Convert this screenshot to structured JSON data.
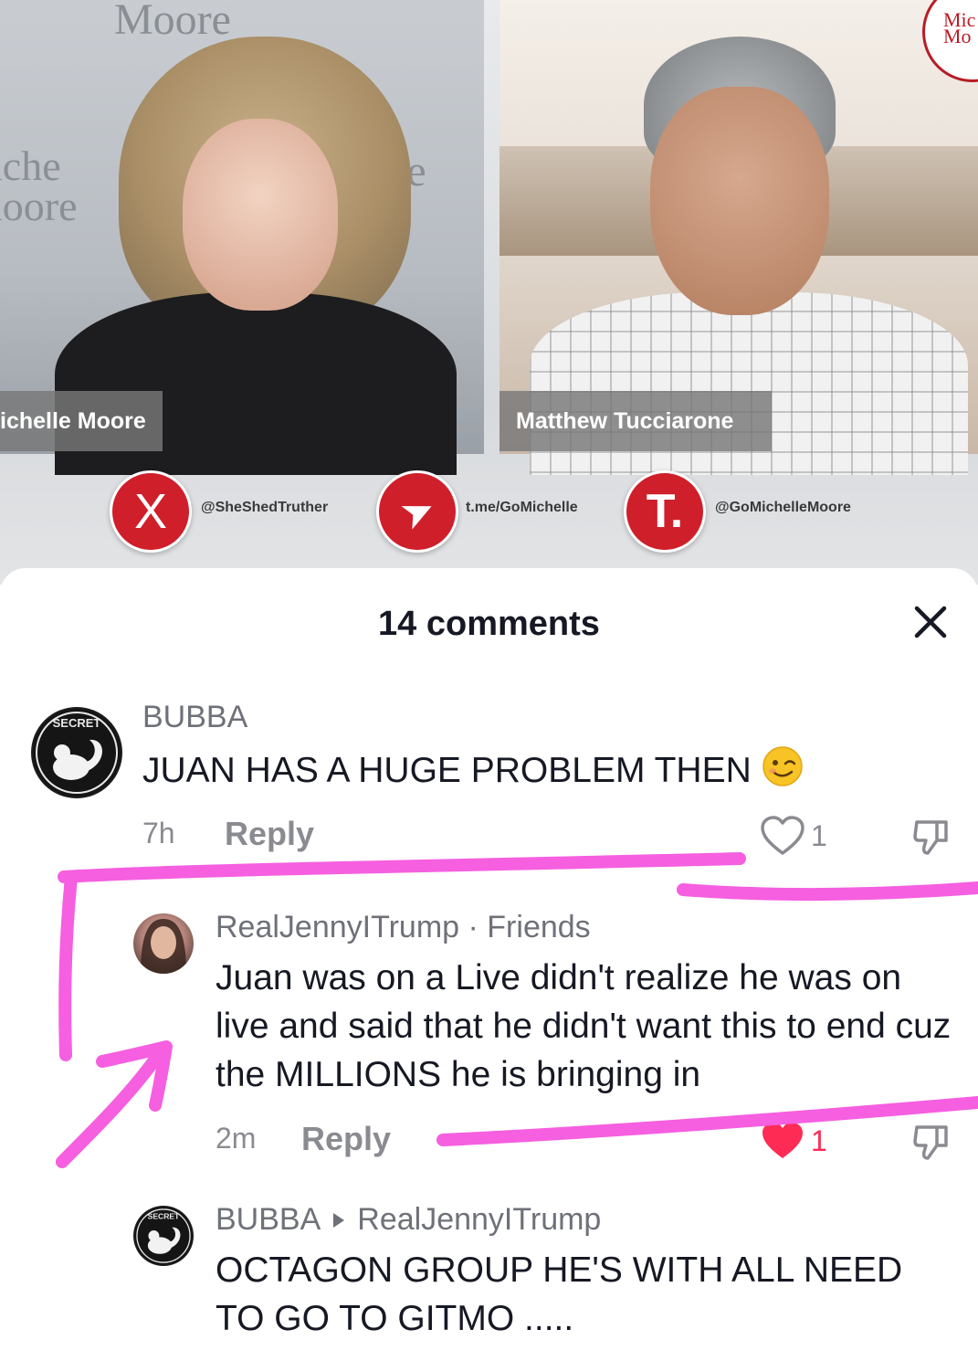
{
  "video": {
    "left_wall_text_top": "Moore",
    "left_wall_text_side": "iche\nloore",
    "left_wall_text_le": "le",
    "right_wall_text": "Mo",
    "host_name": "ichelle Moore",
    "guest_name": "Matthew Tucciarone",
    "brand_badge": "Mic\nMo",
    "socials": [
      {
        "icon": "x-logo-icon",
        "glyph": "X",
        "handle": "@SheShedTruther"
      },
      {
        "icon": "telegram-icon",
        "glyph": "➤",
        "handle": "t.me/GoMichelle"
      },
      {
        "icon": "truth-social-icon",
        "glyph": "T.",
        "handle": "@GoMichelleMoore"
      }
    ]
  },
  "comments_sheet": {
    "title": "14 comments",
    "close_icon": "close-icon"
  },
  "comments": [
    {
      "username": "BUBBA",
      "text": "JUAN HAS A HUGE PROBLEM THEN",
      "emoji": "winking-face",
      "time": "7h",
      "reply_label": "Reply",
      "likes": "1",
      "liked": false
    },
    {
      "username": "RealJennyITrump",
      "relation": " · Friends",
      "text": "Juan was on a Live didn't realize he was on live and said that he didn't want this to end cuz the MILLIONS he is bringing in",
      "time": "2m",
      "reply_label": "Reply",
      "likes": "1",
      "liked": true
    },
    {
      "username": "BUBBA",
      "reply_to": "RealJennyITrump",
      "text": "OCTAGON GROUP HE'S WITH ALL NEED TO GO TO GITMO .....",
      "reply_arrow_icon": "caret-right-icon"
    }
  ],
  "colors": {
    "accent_like": "#fe2c55",
    "annotation": "#f55fe0",
    "social_red": "#cf1f2a"
  }
}
